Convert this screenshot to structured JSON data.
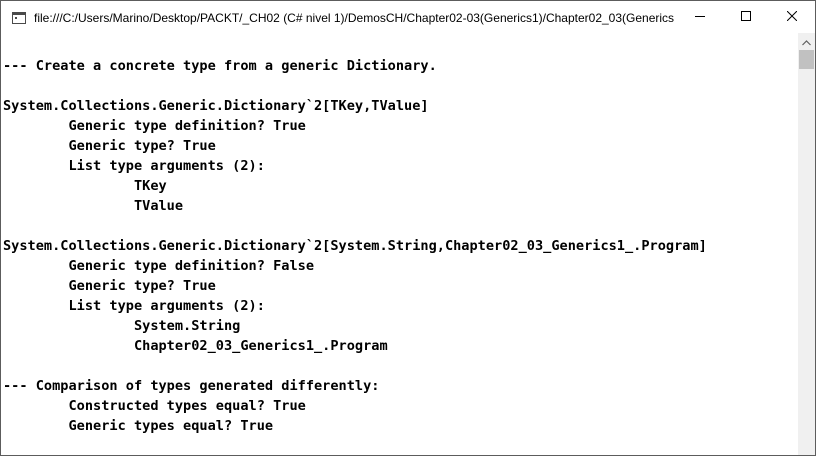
{
  "window": {
    "title": "file:///C:/Users/Marino/Desktop/PACKT/_CH02 (C# nivel 1)/DemosCH/Chapter02-03(Generics1)/Chapter02_03(Generics..."
  },
  "icons": {
    "app": "console-window-icon",
    "minimize": "minimize-icon",
    "maximize": "maximize-icon",
    "close": "close-icon",
    "scroll_up": "chevron-up-icon"
  },
  "console": {
    "lines": [
      "--- Create a concrete type from a generic Dictionary.",
      "",
      "System.Collections.Generic.Dictionary`2[TKey,TValue]",
      "        Generic type definition? True",
      "        Generic type? True",
      "        List type arguments (2):",
      "                TKey",
      "                TValue",
      "",
      "System.Collections.Generic.Dictionary`2[System.String,Chapter02_03_Generics1_.Program]",
      "        Generic type definition? False",
      "        Generic type? True",
      "        List type arguments (2):",
      "                System.String",
      "                Chapter02_03_Generics1_.Program",
      "",
      "--- Comparison of types generated differently:",
      "        Constructed types equal? True",
      "        Generic types equal? True"
    ]
  }
}
